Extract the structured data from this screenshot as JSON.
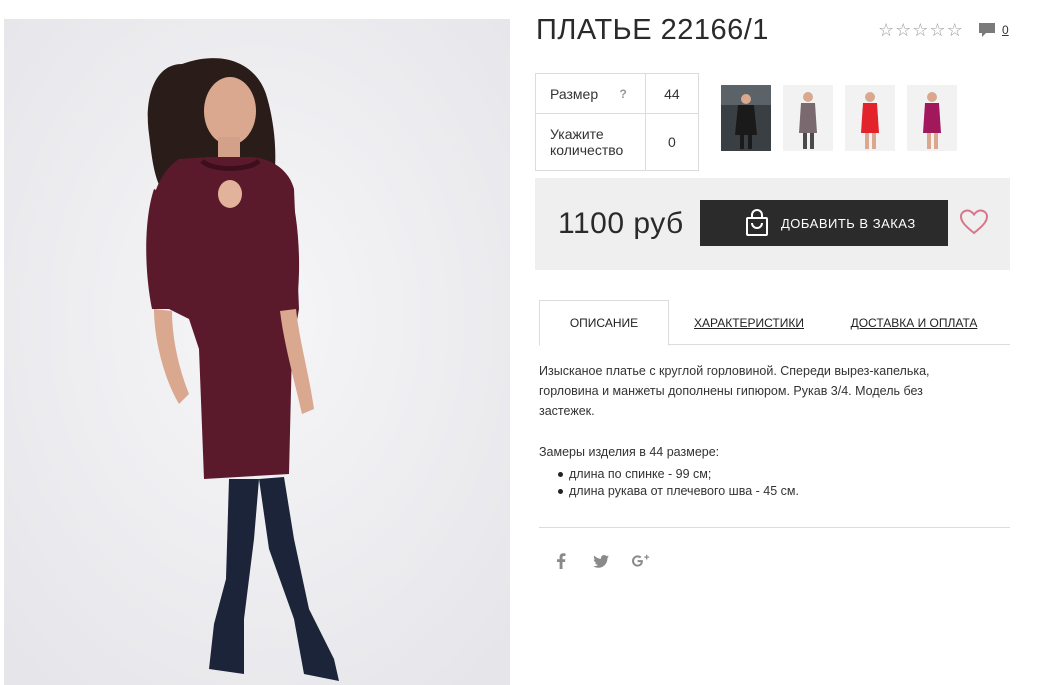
{
  "product": {
    "title": "ПЛАТЬЕ 22166/1",
    "rating_stars": 5,
    "rating_value": 0,
    "comments_count": "0"
  },
  "options": {
    "size_label": "Размер",
    "size_help": "?",
    "size_value": "44",
    "qty_label": "Укажите количество",
    "qty_value": "0"
  },
  "thumbnails": [
    {
      "name": "black-dress",
      "color": "#1a1a1a"
    },
    {
      "name": "grey-dress",
      "color": "#7a6a70"
    },
    {
      "name": "red-dress",
      "color": "#e2232b"
    },
    {
      "name": "magenta-dress",
      "color": "#a1195c"
    }
  ],
  "buy": {
    "price": "1100 руб",
    "add_label": "ДОБАВИТЬ В ЗАКАЗ",
    "icon": "shopping-bag-icon",
    "favorite_icon": "heart-icon"
  },
  "tabs": [
    {
      "label": "ОПИСАНИЕ",
      "active": true
    },
    {
      "label": "ХАРАКТЕРИСТИКИ",
      "active": false
    },
    {
      "label": "ДОСТАВКА И ОПЛАТА",
      "active": false
    }
  ],
  "description": {
    "text": "Изысканое платье с круглой горловиной. Спереди вырез-капелька, горловина и манжеты дополнены гипюром. Рукав 3/4. Модель без застежек.",
    "measures_title": "Замеры изделия в 44 размере:",
    "measures": [
      "длина по спинке - 99 см;",
      "длина рукава от плечевого шва - 45 см."
    ]
  },
  "social": [
    {
      "name": "facebook-icon",
      "glyph": "f"
    },
    {
      "name": "twitter-icon",
      "glyph": "t"
    },
    {
      "name": "google-plus-icon",
      "glyph": "g+"
    }
  ],
  "colors": {
    "dress": "#5a1a2c",
    "boots": "#1b2438",
    "button_bg": "#2b2b2b",
    "price_bar_bg": "#efeff0",
    "heart": "#d8758a"
  }
}
